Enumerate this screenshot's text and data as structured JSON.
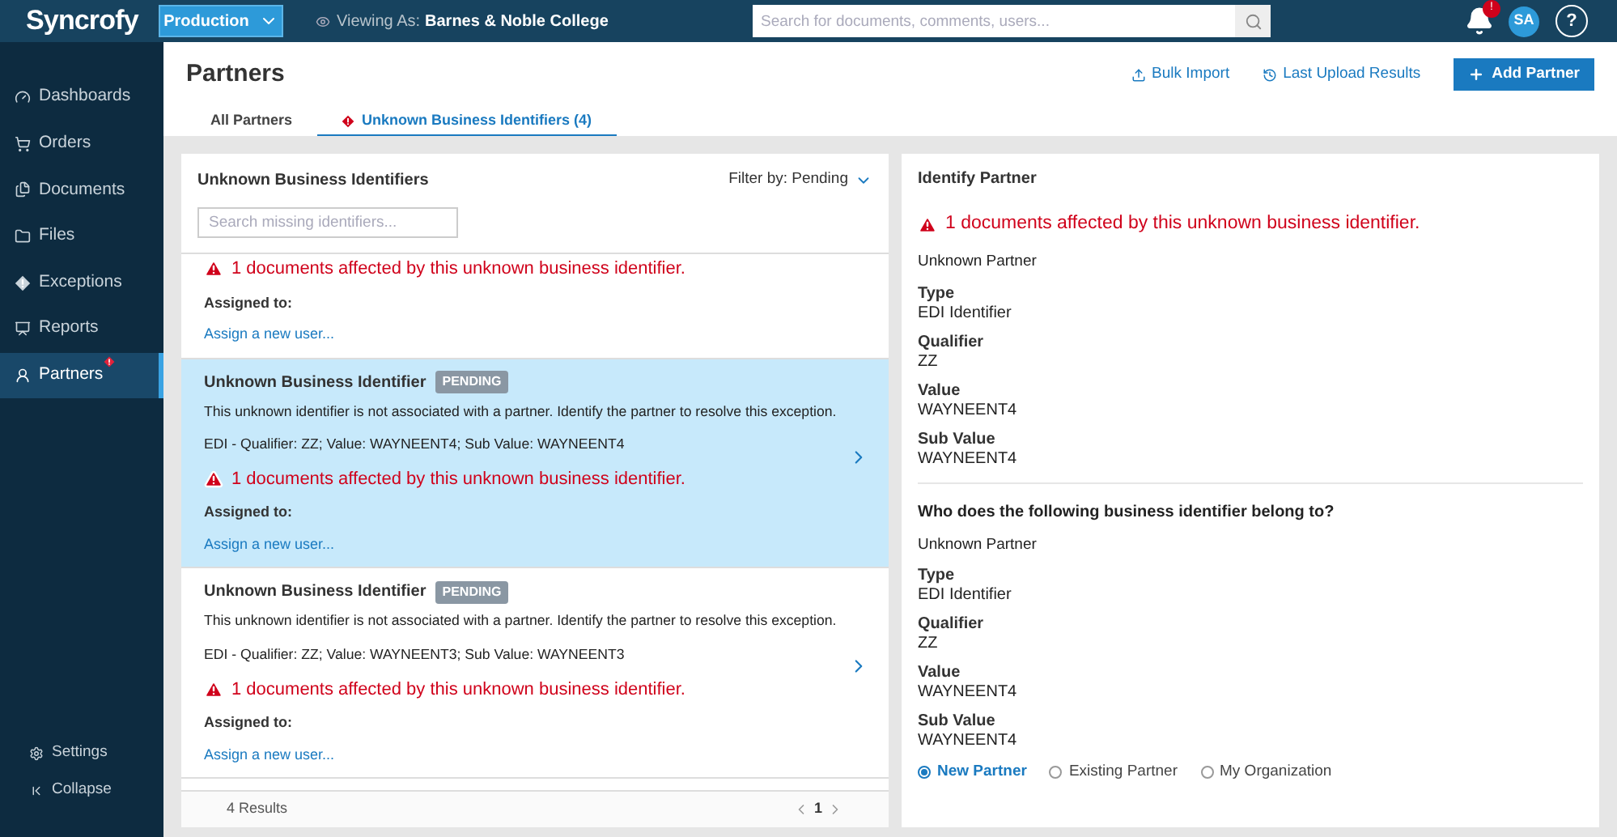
{
  "topbar": {
    "logo": "Syncrofy",
    "environment": "Production",
    "viewing_label": "Viewing As:",
    "viewing_value": "Barnes & Noble College",
    "search": {
      "placeholder": "Search for documents, comments, users..."
    },
    "notification_badge": "!",
    "avatar": "SA",
    "help": "?"
  },
  "sidebar": {
    "items": [
      {
        "label": "Dashboards",
        "selected": false,
        "alert": false
      },
      {
        "label": "Orders",
        "selected": false,
        "alert": false
      },
      {
        "label": "Documents",
        "selected": false,
        "alert": false
      },
      {
        "label": "Files",
        "selected": false,
        "alert": false
      },
      {
        "label": "Exceptions",
        "selected": false,
        "alert": false
      },
      {
        "label": "Reports",
        "selected": false,
        "alert": false
      },
      {
        "label": "Partners",
        "selected": true,
        "alert": true
      }
    ],
    "bottom_items": [
      {
        "label": "Settings"
      },
      {
        "label": "Collapse"
      }
    ]
  },
  "page": {
    "title": "Partners",
    "actions": [
      {
        "label": "Bulk Import",
        "kind": "link"
      },
      {
        "label": "Last Upload Results",
        "kind": "link"
      },
      {
        "label": "Add Partner",
        "kind": "primary"
      }
    ],
    "tabs": [
      {
        "label": "All Partners",
        "selected": false,
        "alert": false
      },
      {
        "label": "Unknown Business Identifiers (4)",
        "selected": true,
        "alert": true
      }
    ]
  },
  "list_panel": {
    "title": "Unknown Business Identifiers",
    "filter": "Filter by: Pending",
    "search": {
      "placeholder": "Search missing identifiers..."
    },
    "items": [
      {
        "warning": "1 documents affected by this unknown business identifier.",
        "assigned_label": "Assigned to:",
        "assign_link": "Assign a new user...",
        "selected": false
      },
      {
        "title": "Unknown Business Identifier",
        "badge": "PENDING",
        "description": "This unknown identifier is not associated with a partner. Identify the partner to resolve this exception.",
        "identifier": "EDI - Qualifier: ZZ; Value: WAYNEENT4; Sub Value: WAYNEENT4",
        "warning": "1 documents affected by this unknown business identifier.",
        "assigned_label": "Assigned to:",
        "assign_link": "Assign a new user...",
        "selected": true
      },
      {
        "title": "Unknown Business Identifier",
        "badge": "PENDING",
        "description": "This unknown identifier is not associated with a partner. Identify the partner to resolve this exception.",
        "identifier": "EDI - Qualifier: ZZ; Value: WAYNEENT3; Sub Value: WAYNEENT3",
        "warning": "1 documents affected by this unknown business identifier.",
        "assigned_label": "Assigned to:",
        "assign_link": "Assign a new user...",
        "selected": false
      }
    ],
    "footer": {
      "results": "4 Results",
      "page": "1"
    }
  },
  "detail_panel": {
    "title": "Identify Partner",
    "warning": "1 documents affected by this unknown business identifier.",
    "partner": "Unknown Partner",
    "fields": [
      {
        "label": "Type",
        "value": "EDI Identifier"
      },
      {
        "label": "Qualifier",
        "value": "ZZ"
      },
      {
        "label": "Value",
        "value": "WAYNEENT4"
      },
      {
        "label": "Sub Value",
        "value": "WAYNEENT4"
      }
    ],
    "question": "Who does the following business identifier belong to?",
    "question_partner": "Unknown Partner",
    "question_fields": [
      {
        "label": "Type",
        "value": "EDI Identifier"
      },
      {
        "label": "Qualifier",
        "value": "ZZ"
      },
      {
        "label": "Value",
        "value": "WAYNEENT4"
      },
      {
        "label": "Sub Value",
        "value": "WAYNEENT4"
      }
    ],
    "options": [
      {
        "label": "New Partner",
        "selected": true
      },
      {
        "label": "Existing Partner",
        "selected": false
      },
      {
        "label": "My Organization",
        "selected": false
      }
    ]
  }
}
